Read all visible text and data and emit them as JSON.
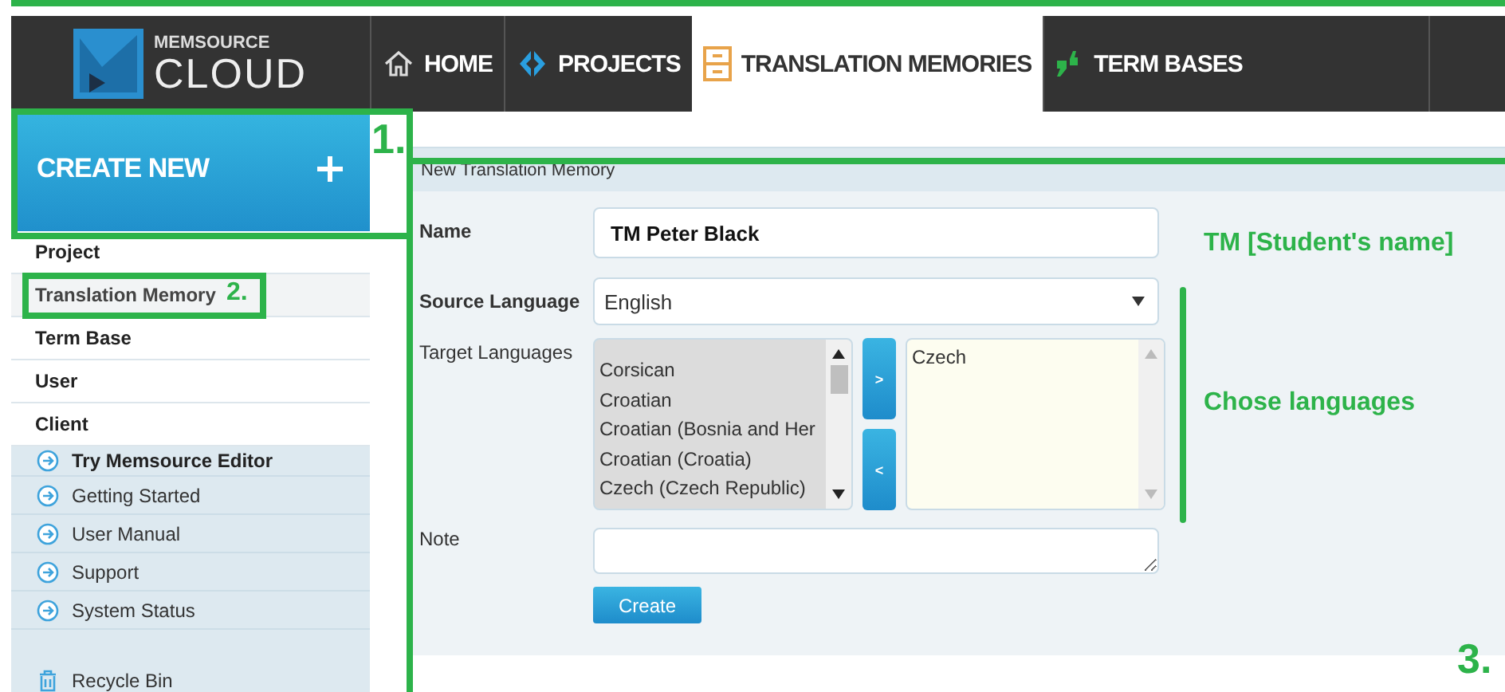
{
  "header": {
    "logo": {
      "top": "MEMSOURCE",
      "bottom": "CLOUD"
    },
    "nav": [
      {
        "label": "HOME",
        "selected": false
      },
      {
        "label": "PROJECTS",
        "selected": false
      },
      {
        "label": "TRANSLATION MEMORIES",
        "selected": true
      },
      {
        "label": "TERM BASES",
        "selected": false
      }
    ]
  },
  "sidebar": {
    "create_button": {
      "label": "CREATE NEW"
    },
    "create_items": [
      {
        "label": "Project",
        "selected": false
      },
      {
        "label": "Translation Memory",
        "selected": true
      },
      {
        "label": "Term Base",
        "selected": false
      },
      {
        "label": "User",
        "selected": false
      },
      {
        "label": "Client",
        "selected": false
      }
    ],
    "help_links": [
      {
        "label": "Try Memsource Editor",
        "bold": true
      },
      {
        "label": "Getting Started",
        "bold": false
      },
      {
        "label": "User Manual",
        "bold": false
      },
      {
        "label": "Support",
        "bold": false
      },
      {
        "label": "System Status",
        "bold": false
      }
    ],
    "recycle_bin": "Recycle Bin"
  },
  "form": {
    "title": "New Translation Memory",
    "name": {
      "label": "Name",
      "value": "TM Peter Black"
    },
    "source_language": {
      "label": "Source Language",
      "value": "English"
    },
    "target_languages": {
      "label": "Target Languages",
      "available": [
        "Corsican",
        "Croatian",
        "Croatian (Bosnia and Her",
        "Croatian (Croatia)",
        "Czech (Czech Republic)"
      ],
      "selected": [
        "Czech"
      ],
      "add_button": ">",
      "remove_button": "<"
    },
    "note": {
      "label": "Note"
    },
    "submit": "Create"
  },
  "annotations": [
    {
      "kind": "step",
      "text": "1."
    },
    {
      "kind": "step",
      "text": "2."
    },
    {
      "kind": "step",
      "text": "3."
    },
    {
      "kind": "note",
      "text": "TM [Student's name]"
    },
    {
      "kind": "note",
      "text": "Chose languages"
    }
  ]
}
